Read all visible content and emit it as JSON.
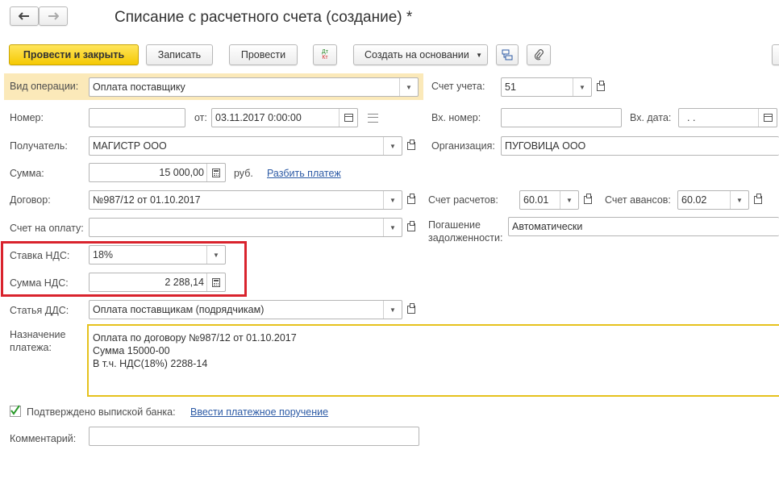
{
  "window": {
    "title": "Списание с расчетного счета (создание) *"
  },
  "nav": {
    "back_icon": "arrow-left-icon",
    "forward_icon": "arrow-right-icon"
  },
  "toolbar": {
    "post_close": "Провести и закрыть",
    "save": "Записать",
    "post": "Провести",
    "dt_kt_top": "Дт",
    "dt_kt_bottom": "Кт",
    "create_based": "Создать на основании"
  },
  "form": {
    "operation_label": "Вид операции:",
    "operation_value": "Оплата поставщику",
    "account_label": "Счет учета:",
    "account_value": "51",
    "number_label": "Номер:",
    "number_value": "",
    "from_label": "от:",
    "date_value": "03.11.2017  0:00:00",
    "in_number_label": "Вх. номер:",
    "in_number_value": "",
    "in_date_label": "Вх. дата:",
    "in_date_value": " .  .",
    "recipient_label": "Получатель:",
    "recipient_value": "МАГИСТР ООО",
    "org_label": "Организация:",
    "org_value": "ПУГОВИЦА ООО",
    "sum_label": "Сумма:",
    "sum_value": "15 000,00",
    "currency": "руб.",
    "split_link": "Разбить платеж",
    "contract_label": "Договор:",
    "contract_value": "№987/12 от 01.10.2017",
    "settle_label": "Счет расчетов:",
    "settle_value": "60.01",
    "advance_label": "Счет авансов:",
    "advance_value": "60.02",
    "invoice_label": "Счет на оплату:",
    "invoice_value": "",
    "debt_label_1": "Погашение",
    "debt_label_2": "задолженности:",
    "debt_value": "Автоматически",
    "vat_rate_label": "Ставка НДС:",
    "vat_rate_value": "18%",
    "vat_sum_label": "Сумма НДС:",
    "vat_sum_value": "2 288,14",
    "dds_label": "Статья ДДС:",
    "dds_value": "Оплата поставщикам (подрядчикам)",
    "purpose_label_1": "Назначение",
    "purpose_label_2": "платежа:",
    "purpose_lines": [
      "Оплата по договору №987/12 от 01.10.2017",
      "Сумма 15000-00",
      "В т.ч. НДС(18%) 2288-14"
    ],
    "confirmed_label": "Подтверждено выпиской банка:",
    "confirmed_checked": true,
    "enter_order_link": "Ввести платежное поручение",
    "comment_label": "Комментарий:",
    "comment_value": ""
  },
  "colors": {
    "highlight_bg": "#fbe9b9",
    "primary_btn": "#f5c902",
    "focus_border": "#e6c21d",
    "red_frame": "#d9232d",
    "link": "#2c5aa5"
  }
}
